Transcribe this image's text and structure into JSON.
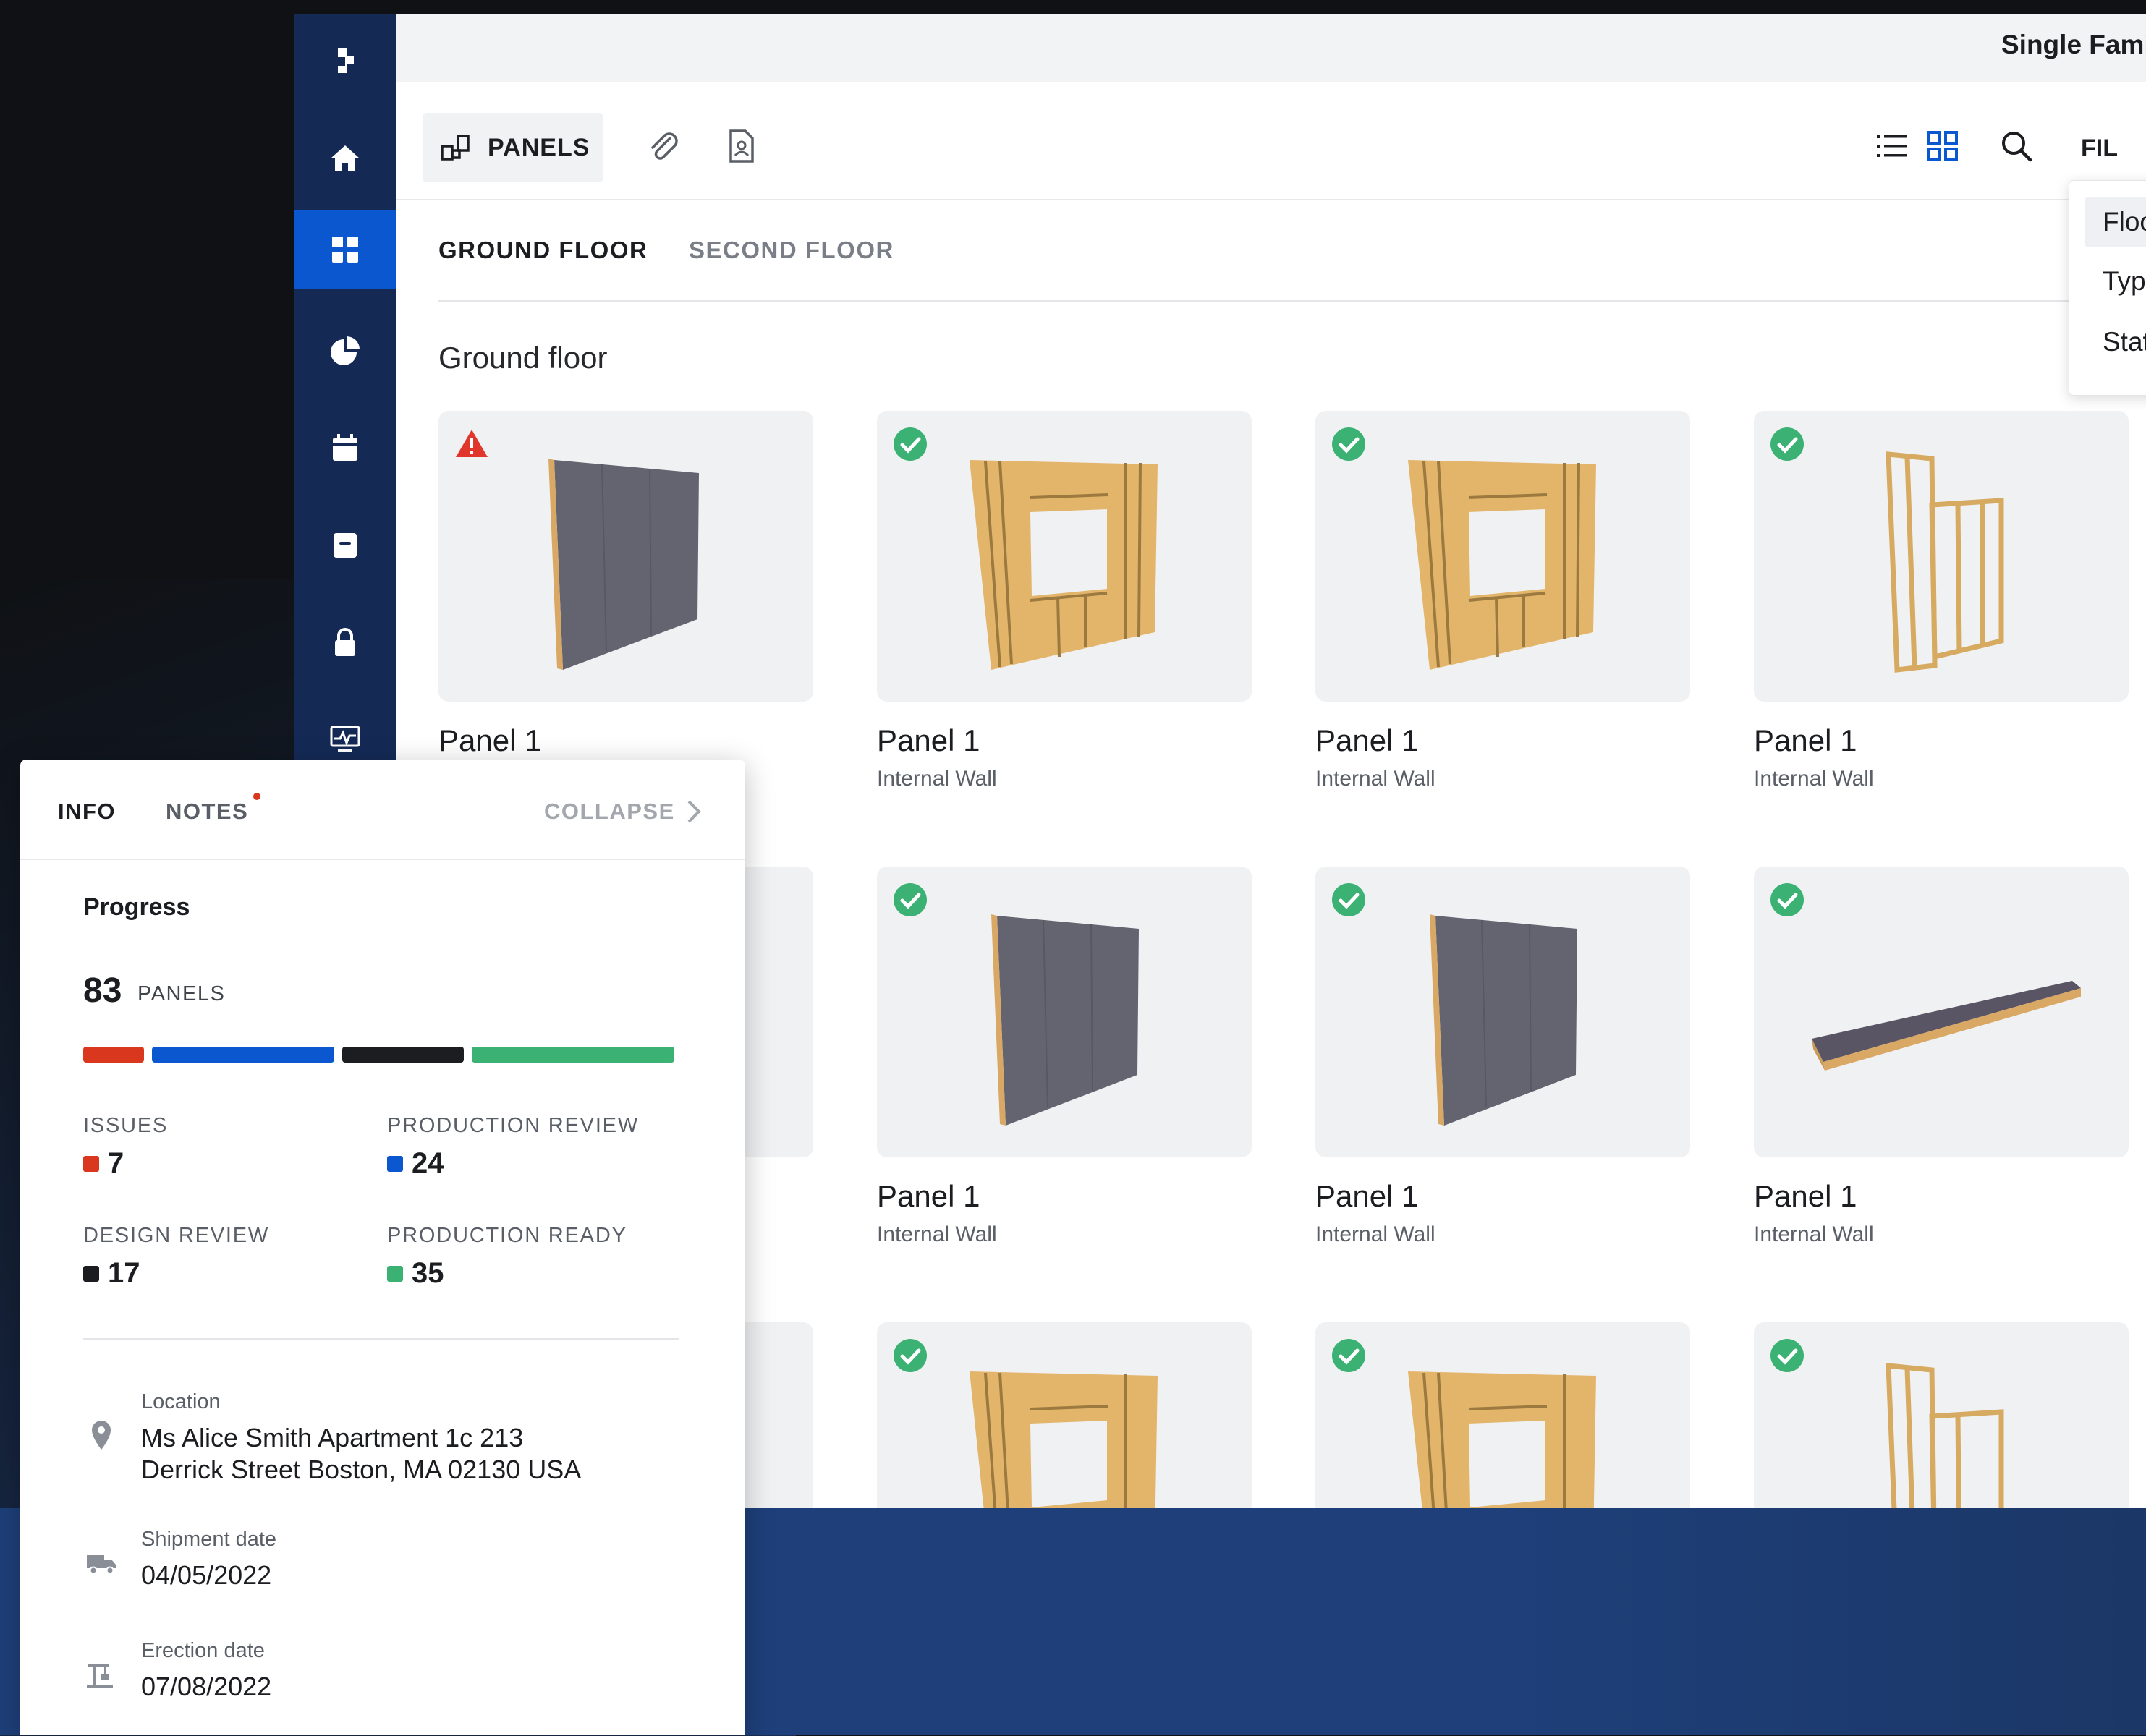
{
  "project_title": "Single Family House",
  "toolbar": {
    "panels_label": "PANELS",
    "filter_label": "FIL"
  },
  "floor_tabs": [
    "GROUND FLOOR",
    "SECOND FLOOR"
  ],
  "section_title": "Ground floor",
  "dropdown": [
    "Floo",
    "Typ",
    "Stat"
  ],
  "cards": [
    {
      "title": "Panel 1",
      "subtitle": "",
      "status": "warning"
    },
    {
      "title": "Panel 1",
      "subtitle": "Internal Wall",
      "status": "ok"
    },
    {
      "title": "Panel 1",
      "subtitle": "Internal Wall",
      "status": "ok"
    },
    {
      "title": "Panel 1",
      "subtitle": "Internal Wall",
      "status": "ok"
    },
    {
      "title": "Panel 1",
      "subtitle": "Internal Wall",
      "status": "ok"
    },
    {
      "title": "Panel 1",
      "subtitle": "Internal Wall",
      "status": "ok"
    },
    {
      "title": "Panel 1",
      "subtitle": "Internal Wall",
      "status": "ok"
    }
  ],
  "info": {
    "tab_info": "INFO",
    "tab_notes": "NOTES",
    "collapse": "COLLAPSE",
    "progress_heading": "Progress",
    "panel_count": "83",
    "panel_unit": "PANELS",
    "stats": {
      "issues_label": "ISSUES",
      "issues_value": "7",
      "prod_review_label": "PRODUCTION REVIEW",
      "prod_review_value": "24",
      "design_review_label": "DESIGN REVIEW",
      "design_review_value": "17",
      "prod_ready_label": "PRODUCTION READY",
      "prod_ready_value": "35"
    },
    "location_label": "Location",
    "location_line1": "Ms Alice Smith Apartment 1c 213",
    "location_line2": "Derrick Street Boston, MA 02130 USA",
    "shipment_label": "Shipment date",
    "shipment_value": "04/05/2022",
    "erection_label": "Erection date",
    "erection_value": "07/08/2022"
  },
  "colors": {
    "sidebar": "#142a55",
    "accent": "#0b57d0",
    "issues": "#d9371e",
    "production_review": "#0b57d0",
    "design_review": "#1b1d21",
    "production_ready": "#3bb273",
    "bottom_band": "#1e3f7a"
  },
  "icons": {
    "sidebar": [
      "logo-icon",
      "home-icon",
      "grid-icon",
      "pie-chart-icon",
      "calendar-icon",
      "archive-icon",
      "lock-icon",
      "monitor-icon"
    ],
    "toolbar": [
      "panels-icon",
      "paperclip-icon",
      "document-icon",
      "list-view-icon",
      "grid-view-icon",
      "search-icon"
    ]
  }
}
